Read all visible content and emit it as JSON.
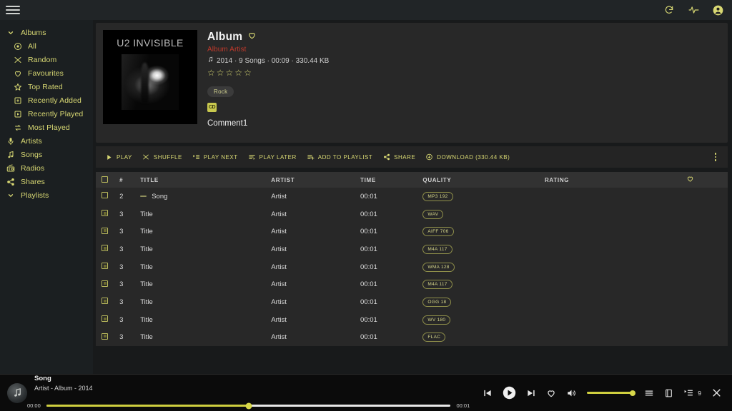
{
  "topbar": {
    "menu_icon": "hamburger-icon",
    "icons": [
      {
        "name": "refresh-icon",
        "glyph": "⟳"
      },
      {
        "name": "activity-icon",
        "glyph": "∿"
      },
      {
        "name": "user-avatar-icon",
        "glyph": "●"
      }
    ]
  },
  "sidebar": {
    "items": [
      {
        "label": "Albums",
        "icon": "chevron-down-icon",
        "sub": false,
        "name": "sidebar-item-albums"
      },
      {
        "label": "All",
        "icon": "circle-dot-icon",
        "sub": true,
        "name": "sidebar-item-all"
      },
      {
        "label": "Random",
        "icon": "shuffle-icon",
        "sub": true,
        "name": "sidebar-item-random"
      },
      {
        "label": "Favourites",
        "icon": "heart-icon",
        "sub": true,
        "name": "sidebar-item-favourites"
      },
      {
        "label": "Top Rated",
        "icon": "star-icon",
        "sub": true,
        "name": "sidebar-item-top-rated"
      },
      {
        "label": "Recently Added",
        "icon": "add-box-icon",
        "sub": true,
        "name": "sidebar-item-recently-added"
      },
      {
        "label": "Recently Played",
        "icon": "play-box-icon",
        "sub": true,
        "name": "sidebar-item-recently-played"
      },
      {
        "label": "Most Played",
        "icon": "repeat-icon",
        "sub": true,
        "name": "sidebar-item-most-played"
      },
      {
        "label": "Artists",
        "icon": "microphone-icon",
        "sub": false,
        "name": "sidebar-item-artists"
      },
      {
        "label": "Songs",
        "icon": "music-note-icon",
        "sub": false,
        "name": "sidebar-item-songs"
      },
      {
        "label": "Radios",
        "icon": "radio-icon",
        "sub": false,
        "name": "sidebar-item-radios"
      },
      {
        "label": "Shares",
        "icon": "share-icon",
        "sub": false,
        "name": "sidebar-item-shares"
      },
      {
        "label": "Playlists",
        "icon": "chevron-down-icon",
        "sub": false,
        "name": "sidebar-item-playlists"
      }
    ]
  },
  "album": {
    "cover_title": "U2 INVISIBLE",
    "title": "Album",
    "artist": "Album Artist",
    "stats": "2014 · 9 Songs · 00:09 · 330.44 KB",
    "stats_icon": "music-note-icon",
    "rating_stars": 5,
    "rating_filled": 0,
    "tags": [
      "Rock"
    ],
    "badge_label": "CD",
    "comment": "Comment1",
    "favourite_icon": "heart-icon"
  },
  "toolbar": {
    "buttons": [
      {
        "label": "PLAY",
        "icon": "play-icon",
        "name": "play-button"
      },
      {
        "label": "SHUFFLE",
        "icon": "shuffle-icon",
        "name": "shuffle-button"
      },
      {
        "label": "PLAY NEXT",
        "icon": "play-next-icon",
        "name": "play-next-button"
      },
      {
        "label": "PLAY LATER",
        "icon": "play-later-icon",
        "name": "play-later-button"
      },
      {
        "label": "ADD TO PLAYLIST",
        "icon": "add-playlist-icon",
        "name": "add-to-playlist-button"
      },
      {
        "label": "SHARE",
        "icon": "share-icon",
        "name": "share-button"
      },
      {
        "label": "DOWNLOAD (330.44 KB)",
        "icon": "download-icon",
        "name": "download-button"
      }
    ],
    "overflow_icon": "kebab-menu-icon"
  },
  "table": {
    "columns": [
      "#",
      "TITLE",
      "ARTIST",
      "TIME",
      "QUALITY",
      "RATING"
    ],
    "fav_column_icon": "heart-icon",
    "rows": [
      {
        "num": "2",
        "title": "Song",
        "artist": "Artist",
        "time": "00:01",
        "quality": "MP3 192",
        "rating": "",
        "playing": true
      },
      {
        "num": "3",
        "title": "Title",
        "artist": "Artist",
        "time": "00:01",
        "quality": "WAV",
        "rating": "",
        "playing": false
      },
      {
        "num": "3",
        "title": "Title",
        "artist": "Artist",
        "time": "00:01",
        "quality": "AIFF 706",
        "rating": "",
        "playing": false
      },
      {
        "num": "3",
        "title": "Title",
        "artist": "Artist",
        "time": "00:01",
        "quality": "M4A 117",
        "rating": "",
        "playing": false
      },
      {
        "num": "3",
        "title": "Title",
        "artist": "Artist",
        "time": "00:01",
        "quality": "WMA 128",
        "rating": "",
        "playing": false
      },
      {
        "num": "3",
        "title": "Title",
        "artist": "Artist",
        "time": "00:01",
        "quality": "M4A 117",
        "rating": "",
        "playing": false
      },
      {
        "num": "3",
        "title": "Title",
        "artist": "Artist",
        "time": "00:01",
        "quality": "OGG 18",
        "rating": "",
        "playing": false
      },
      {
        "num": "3",
        "title": "Title",
        "artist": "Artist",
        "time": "00:01",
        "quality": "WV 180",
        "rating": "",
        "playing": false
      },
      {
        "num": "3",
        "title": "Title",
        "artist": "Artist",
        "time": "00:01",
        "quality": "FLAC",
        "rating": "",
        "playing": false
      }
    ]
  },
  "player": {
    "song": "Song",
    "subtitle": "Artist - Album - 2014",
    "elapsed": "00:00",
    "duration": "00:01",
    "progress_percent": 50,
    "volume_percent": 100,
    "queue_count": "9",
    "controls": [
      {
        "name": "previous-track-button",
        "icon": "skip-previous-icon"
      },
      {
        "name": "play-pause-button",
        "icon": "play-circle-icon"
      },
      {
        "name": "next-track-button",
        "icon": "skip-next-icon"
      },
      {
        "name": "favourite-button",
        "icon": "heart-icon"
      },
      {
        "name": "volume-button",
        "icon": "volume-icon"
      },
      {
        "name": "queue-button",
        "icon": "list-icon"
      },
      {
        "name": "lyrics-button",
        "icon": "book-icon"
      },
      {
        "name": "playlist-button",
        "icon": "playlist-icon"
      },
      {
        "name": "close-player-button",
        "icon": "close-icon"
      }
    ]
  },
  "colors": {
    "accent": "#d8d873",
    "artist_red": "#c0392b",
    "panel": "#282828",
    "sidebar": "#1b1f21",
    "header_row": "#323232",
    "player_bg": "#0b0b0b"
  }
}
